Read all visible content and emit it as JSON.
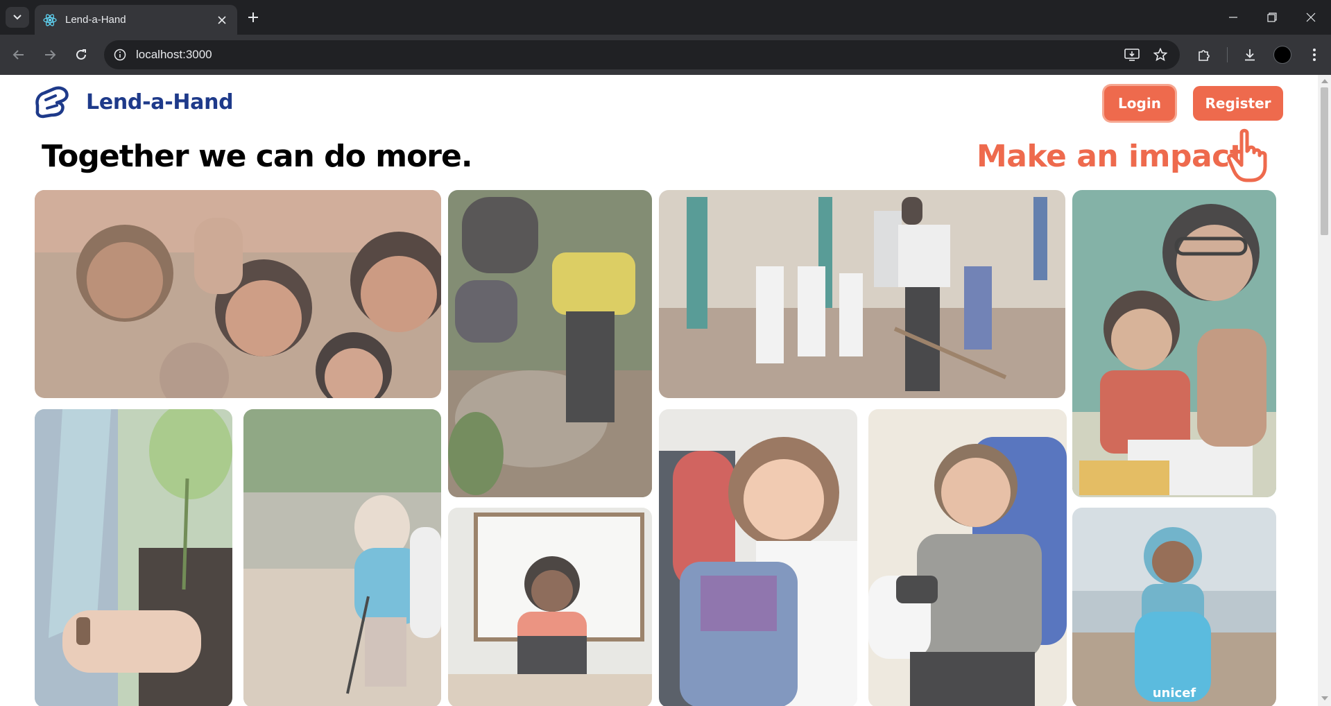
{
  "browser": {
    "tab_title": "Lend-a-Hand",
    "url": "localhost:3000"
  },
  "site": {
    "brand": "Lend-a-Hand",
    "login_label": "Login",
    "register_label": "Register",
    "headline": "Together we can do more.",
    "cta_text": "Make an impact"
  },
  "colors": {
    "brand_blue": "#1e3a8a",
    "accent": "#ee6a4d"
  },
  "gallery": [
    {
      "name": "children-smiling-photo"
    },
    {
      "name": "forest-cleanup-photo"
    },
    {
      "name": "tree-planting-photo"
    },
    {
      "name": "volunteer-teaching-child-photo"
    },
    {
      "name": "hand-planting-sapling-photo"
    },
    {
      "name": "riverbank-litter-picking-photo"
    },
    {
      "name": "online-teacher-laptop-photo"
    },
    {
      "name": "clothing-donation-photo"
    },
    {
      "name": "blood-donor-photo"
    },
    {
      "name": "unicef-girl-backpack-photo",
      "caption": "unicef"
    }
  ]
}
